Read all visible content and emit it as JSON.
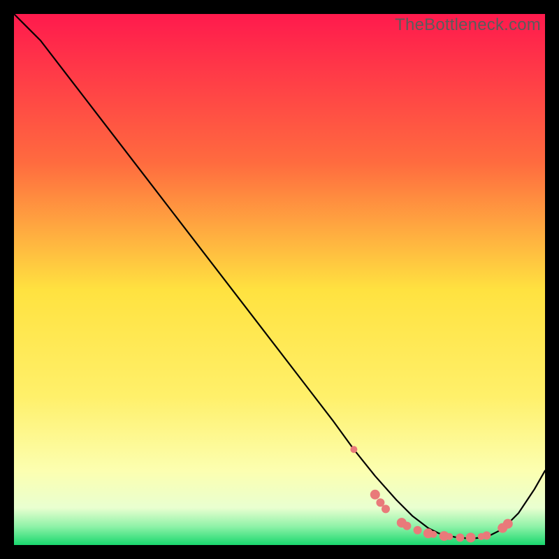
{
  "watermark": "TheBottleneck.com",
  "chart_data": {
    "type": "line",
    "title": "",
    "xlabel": "",
    "ylabel": "",
    "xlim": [
      0,
      100
    ],
    "ylim": [
      0,
      100
    ],
    "grid": false,
    "legend": false,
    "background_gradient": {
      "top_color": "#ff1a4d",
      "mid_upper_color": "#ff8a3a",
      "mid_color": "#ffe240",
      "mid_lower_color": "#faff66",
      "low_band_color": "#ffffc0",
      "green_band_color": "#2ee87a",
      "bottom_color": "#19d86e"
    },
    "series": [
      {
        "name": "bottleneck-curve",
        "x": [
          0,
          3,
          5,
          10,
          15,
          20,
          25,
          30,
          35,
          40,
          45,
          50,
          55,
          60,
          64,
          68,
          72,
          75,
          78,
          80,
          83,
          86,
          89,
          92,
          95,
          98,
          100
        ],
        "y": [
          100,
          97,
          95,
          88.5,
          82,
          75.5,
          69,
          62.5,
          56,
          49.5,
          43,
          36.5,
          30,
          23.5,
          18,
          13,
          8.5,
          5.5,
          3.2,
          2.2,
          1.5,
          1.2,
          1.5,
          3.0,
          6.0,
          10.5,
          14
        ]
      }
    ],
    "markers": {
      "name": "highlight-points",
      "color": "#e97a7a",
      "points": [
        {
          "x": 64,
          "y": 18.0,
          "r": 5
        },
        {
          "x": 68,
          "y": 9.5,
          "r": 7
        },
        {
          "x": 69,
          "y": 8.0,
          "r": 6
        },
        {
          "x": 70,
          "y": 6.8,
          "r": 6
        },
        {
          "x": 73,
          "y": 4.2,
          "r": 7
        },
        {
          "x": 74,
          "y": 3.6,
          "r": 6
        },
        {
          "x": 76,
          "y": 2.8,
          "r": 6
        },
        {
          "x": 78,
          "y": 2.2,
          "r": 7
        },
        {
          "x": 79,
          "y": 2.0,
          "r": 5
        },
        {
          "x": 81,
          "y": 1.7,
          "r": 7
        },
        {
          "x": 82,
          "y": 1.6,
          "r": 5
        },
        {
          "x": 84,
          "y": 1.4,
          "r": 6
        },
        {
          "x": 86,
          "y": 1.4,
          "r": 7
        },
        {
          "x": 88,
          "y": 1.6,
          "r": 5
        },
        {
          "x": 89,
          "y": 1.8,
          "r": 6
        },
        {
          "x": 92,
          "y": 3.2,
          "r": 7
        },
        {
          "x": 93,
          "y": 4.0,
          "r": 7
        }
      ]
    }
  }
}
